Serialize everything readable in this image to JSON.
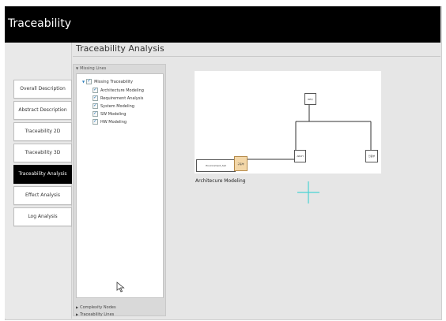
{
  "app": {
    "title": "Traceability"
  },
  "nav": {
    "items": [
      {
        "label": "Overall Description",
        "active": false
      },
      {
        "label": "Abstract Description",
        "active": false
      },
      {
        "label": "Traceability 2D",
        "active": false
      },
      {
        "label": "Traceability 3D",
        "active": false
      },
      {
        "label": "Traceability Analysis",
        "active": true
      },
      {
        "label": "Effect Analysis",
        "active": false
      },
      {
        "label": "Log Analysis",
        "active": false
      }
    ]
  },
  "main": {
    "title": "Traceability Analysis",
    "missing_lines_header": "Missing Lines",
    "tree_root": "Missing Traceability",
    "tree_children": [
      "Architecture Modeling",
      "Requirement Analysis",
      "System Modeling",
      "SW Modeling",
      "HW Modeling"
    ],
    "bottom_sections": [
      "Complexity Nodes",
      "Traceability Lines"
    ]
  },
  "diagram": {
    "nodes": {
      "environment": "Environment_Set",
      "highlight": "구동부",
      "top": "REQ",
      "middle": "ARCH",
      "right": "전원부"
    },
    "caption": "Architecure Modeling"
  }
}
